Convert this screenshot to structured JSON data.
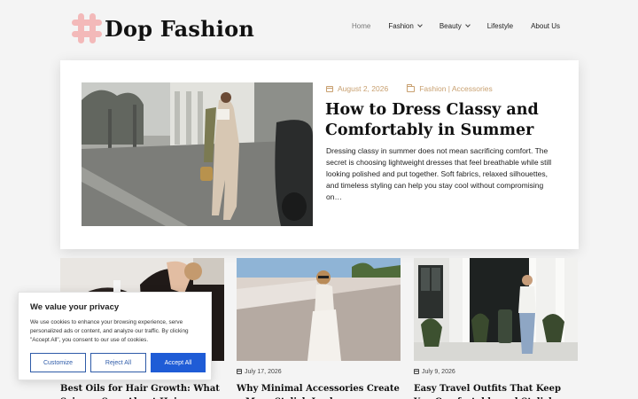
{
  "site": {
    "name": "Dop Fashion",
    "logo_color": "#f3b9b9"
  },
  "nav": [
    {
      "label": "Home",
      "active": true,
      "dropdown": false
    },
    {
      "label": "Fashion",
      "active": false,
      "dropdown": true
    },
    {
      "label": "Beauty",
      "active": false,
      "dropdown": true
    },
    {
      "label": "Lifestyle",
      "active": false,
      "dropdown": false
    },
    {
      "label": "About Us",
      "active": false,
      "dropdown": false
    }
  ],
  "featured": {
    "date": "August 2, 2026",
    "category": "Fashion | Accessories",
    "title": "How to Dress Classy and Comfortably in Summer",
    "excerpt": "Dressing classy in summer does not mean sacrificing comfort. The secret is choosing lightweight dresses that feel breathable while still looking polished and put together. Soft fabrics, relaxed silhouettes, and timeless styling can help you stay cool without compromising on…",
    "accent": "#c8a070"
  },
  "cards": [
    {
      "date": "",
      "title": "Best Oils for Hair Growth: What Science Says About Hair"
    },
    {
      "date": "July 17, 2026",
      "title": "Why Minimal Accessories Create a More Stylish Look"
    },
    {
      "date": "July 9, 2026",
      "title": "Easy Travel Outfits That Keep You Comfortable and Stylish"
    }
  ],
  "cookie": {
    "title": "We value your privacy",
    "text": "We use cookies to enhance your browsing experience, serve personalized ads or content, and analyze our traffic. By clicking \"Accept All\", you consent to our use of cookies.",
    "customize": "Customize",
    "reject": "Reject All",
    "accept": "Accept All",
    "accent": "#1f5cd6"
  }
}
